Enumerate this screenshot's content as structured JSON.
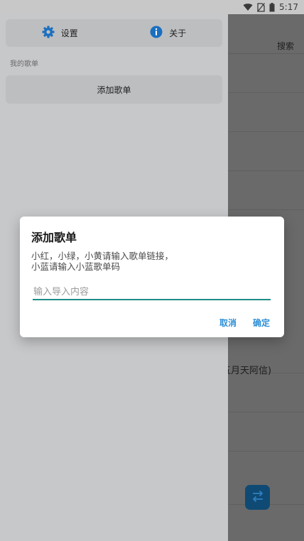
{
  "status_bar": {
    "time": "5:17",
    "icons": [
      "wifi-icon",
      "no-sim-icon",
      "battery-icon"
    ]
  },
  "main_screen": {
    "search_label": "搜索",
    "visible_fragment": "五月天阿信)",
    "fab_icon": "swap-arrows-icon"
  },
  "drawer": {
    "top_buttons": [
      {
        "label": "设置",
        "icon": "gear-icon"
      },
      {
        "label": "关于",
        "icon": "info-icon"
      }
    ],
    "section_label": "我的歌单",
    "add_playlist_label": "添加歌单"
  },
  "dialog": {
    "title": "添加歌单",
    "message_line1": "小红，小绿，小黄请输入歌单链接，",
    "message_line2": "小蓝请输入小蓝歌单码",
    "input_value": "",
    "input_placeholder": "输入导入内容",
    "cancel_label": "取消",
    "confirm_label": "确定"
  },
  "colors": {
    "accent_blue": "#2d8fd6",
    "input_underline": "#1e8c88",
    "fab": "#0f4a74"
  }
}
